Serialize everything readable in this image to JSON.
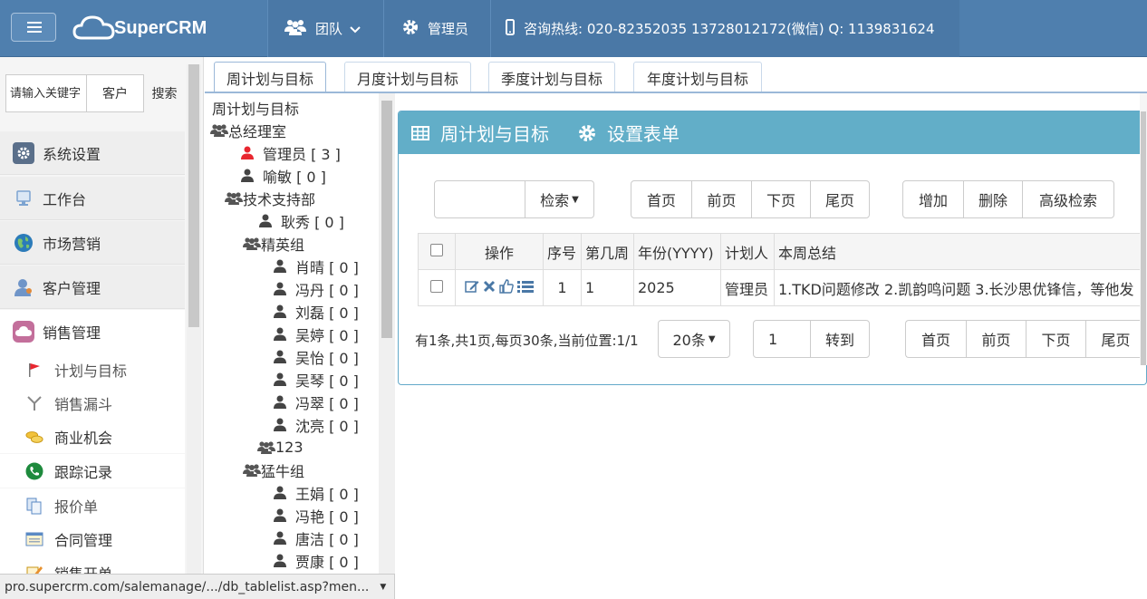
{
  "topbar": {
    "logo": "SuperCRM",
    "team": "团队",
    "admin": "管理员",
    "hotline": "咨询热线: 020-82352035 13728012172(微信) Q: 1139831624"
  },
  "sidebar": {
    "search_placeholder": "请输入关键字",
    "customer_label": "客户",
    "search_label": "搜索",
    "main_items": [
      {
        "label": "系统设置",
        "icon": "gear-icon",
        "color": "#5a6f8a"
      },
      {
        "label": "工作台",
        "icon": "monitor-icon",
        "color": "#7da4d1"
      },
      {
        "label": "市场营销",
        "icon": "globe-icon",
        "color": "#2b7bb9"
      },
      {
        "label": "客户管理",
        "icon": "user-icon",
        "color": "#6f95c8"
      },
      {
        "label": "销售管理",
        "icon": "cloud-icon",
        "color": "#c36f9b"
      }
    ],
    "sub_items": [
      {
        "label": "计划与目标",
        "icon": "flag-icon"
      },
      {
        "label": "销售漏斗",
        "icon": "funnel-icon"
      },
      {
        "label": "商业机会",
        "icon": "coins-icon"
      },
      {
        "label": "跟踪记录",
        "icon": "phone-icon"
      },
      {
        "label": "报价单",
        "icon": "docs-icon"
      },
      {
        "label": "合同管理",
        "icon": "contract-icon"
      },
      {
        "label": "销售开单",
        "icon": "pen-icon"
      }
    ]
  },
  "tabs": [
    "周计划与目标",
    "月度计划与目标",
    "季度计划与目标",
    "年度计划与目标"
  ],
  "tree": {
    "root": "周计划与目标",
    "nodes": [
      {
        "label": "总经理室",
        "type": "group",
        "level": 0
      },
      {
        "label": "管理员 [ 3 ]",
        "type": "user-active",
        "level": 1
      },
      {
        "label": "喻敏 [ 0 ]",
        "type": "user",
        "level": 1
      },
      {
        "label": "技术支持部",
        "type": "group",
        "level": 1
      },
      {
        "label": "耿秀 [ 0 ]",
        "type": "user",
        "level": 2
      },
      {
        "label": "精英组",
        "type": "group",
        "level": 2
      },
      {
        "label": "肖晴 [ 0 ]",
        "type": "user",
        "level": 3
      },
      {
        "label": "冯丹 [ 0 ]",
        "type": "user",
        "level": 3
      },
      {
        "label": "刘磊 [ 0 ]",
        "type": "user",
        "level": 3
      },
      {
        "label": "吴婷 [ 0 ]",
        "type": "user",
        "level": 3
      },
      {
        "label": "吴怡 [ 0 ]",
        "type": "user",
        "level": 3
      },
      {
        "label": "吴琴 [ 0 ]",
        "type": "user",
        "level": 3
      },
      {
        "label": "冯翠 [ 0 ]",
        "type": "user",
        "level": 3
      },
      {
        "label": "沈亮 [ 0 ]",
        "type": "user",
        "level": 3
      },
      {
        "label": "123",
        "type": "group",
        "level": 3
      },
      {
        "label": "猛牛组",
        "type": "group",
        "level": 2
      },
      {
        "label": "王娟 [ 0 ]",
        "type": "user",
        "level": 3
      },
      {
        "label": "冯艳 [ 0 ]",
        "type": "user",
        "level": 3
      },
      {
        "label": "唐洁 [ 0 ]",
        "type": "user",
        "level": 3
      },
      {
        "label": "贾康 [ 0 ]",
        "type": "user",
        "level": 3
      }
    ]
  },
  "panel": {
    "title": "周计划与目标",
    "settings": "设置表单",
    "search_btn": "检索",
    "nav_top": [
      "首页",
      "前页",
      "下页",
      "尾页"
    ],
    "actions": [
      "增加",
      "删除",
      "高级检索"
    ],
    "columns": [
      "操作",
      "序号",
      "第几周",
      "年份(YYYY)",
      "计划人",
      "本周总结"
    ],
    "rows": [
      {
        "seq": "1",
        "week": "1",
        "year": "2025",
        "planner": "管理员",
        "summary": "1.TKD问题修改 2.凯韵鸣问题 3.长沙思优锋信，等他发"
      }
    ],
    "pager_info": "有1条,共1页,每页30条,当前位置:1/1",
    "page_size": "20条",
    "page_input": "1",
    "goto": "转到",
    "nav_bottom": [
      "首页",
      "前页",
      "下页",
      "尾页"
    ]
  },
  "statusbar": "pro.supercrm.com/salemanage/.../db_tablelist.asp?men..."
}
